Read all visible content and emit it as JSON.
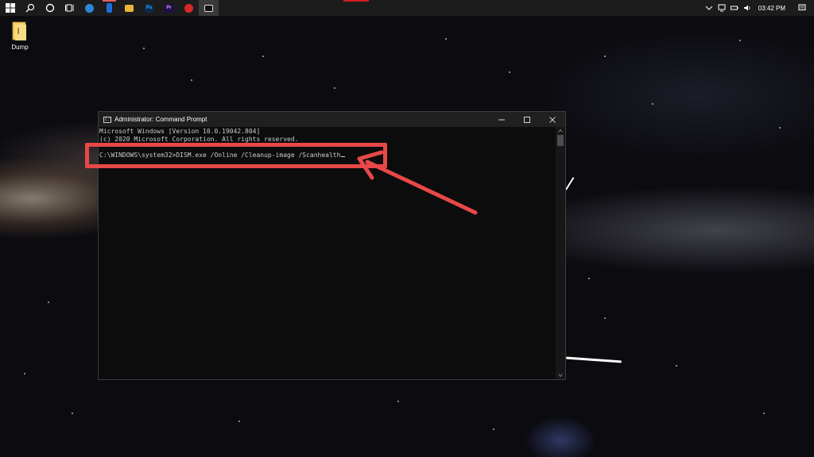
{
  "taskbar": {
    "apps": [
      {
        "name": "edge",
        "color": "#2b88d8",
        "text": ""
      },
      {
        "name": "phone-app",
        "color": "#1e6fd9",
        "text": ""
      },
      {
        "name": "file-explorer",
        "color": "#e8b53a",
        "text": ""
      },
      {
        "name": "photoshop",
        "color": "#0b2a4a",
        "text": "Ps"
      },
      {
        "name": "premiere",
        "color": "#1f0f4a",
        "text": "Pr"
      },
      {
        "name": "red-app",
        "color": "#d62626",
        "text": ""
      },
      {
        "name": "command-prompt",
        "color": "#222222",
        "text": ""
      }
    ],
    "clock": "03:42 PM"
  },
  "desktop": {
    "icon_label": "Dump"
  },
  "cmd": {
    "title": "Administrator: Command Prompt",
    "icon_text": "C:\\",
    "lines": [
      "Microsoft Windows [Version 10.0.19042.804]",
      "(c) 2020 Microsoft Corporation. All rights reserved."
    ],
    "prompt": "C:\\WINDOWS\\system32>",
    "command": "DISM.exe /Online /Cleanup-image /Scanhealth"
  },
  "colors": {
    "annotation": "#e84848",
    "cmd_background": "#0c0c0c",
    "cmd_text": "#cccccc",
    "taskbar": "#1c1c1c"
  }
}
